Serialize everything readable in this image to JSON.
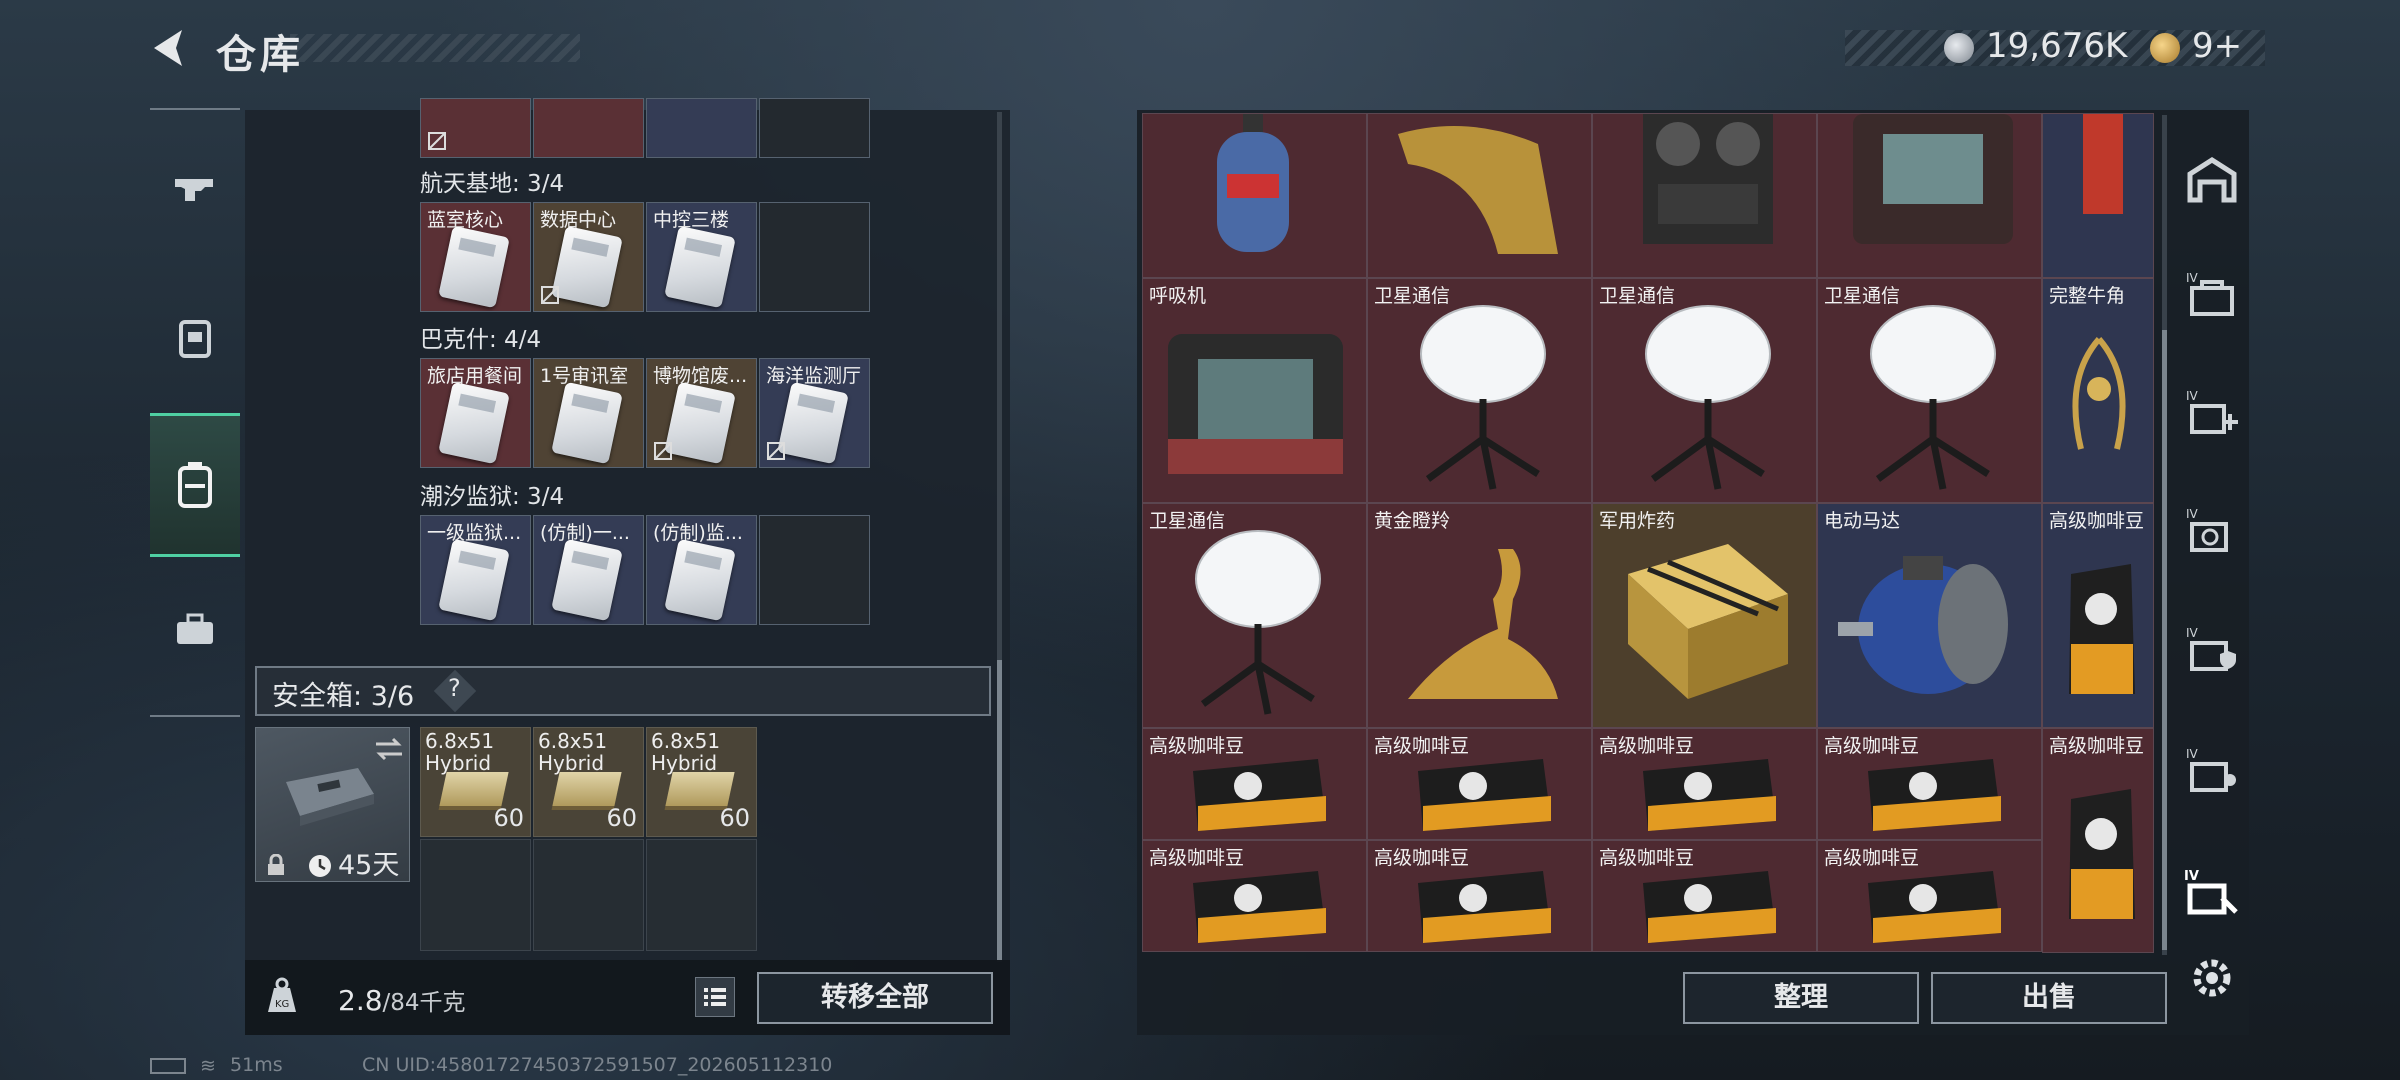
{
  "header": {
    "title": "仓库",
    "silver": "19,676K",
    "gold": "9+"
  },
  "left": {
    "sections": [
      {
        "label": "航天基地: 3/4",
        "cards": [
          "蓝室核心",
          "数据中心",
          "中控三楼",
          ""
        ]
      },
      {
        "label": "巴克什: 4/4",
        "cards": [
          "旅店用餐间",
          "1号审讯室",
          "博物馆废...",
          "海洋监测厅"
        ]
      },
      {
        "label": "潮汐监狱: 3/4",
        "cards": [
          "一级监狱...",
          "(仿制)一...",
          "(仿制)监...",
          ""
        ]
      }
    ],
    "safe": {
      "label": "安全箱:",
      "count": "3/6",
      "help": "?",
      "days": "45天"
    },
    "ammo": [
      {
        "name": "6.8x51 Hybrid",
        "qty": "60"
      },
      {
        "name": "6.8x51 Hybrid",
        "qty": "60"
      },
      {
        "name": "6.8x51 Hybrid",
        "qty": "60"
      }
    ],
    "weight": {
      "current": "2.8",
      "cap": "/84千克"
    },
    "transfer": "转移全部"
  },
  "grid": {
    "row1": [
      "",
      "",
      "",
      "",
      ""
    ],
    "row2": [
      "呼吸机",
      "卫星通信",
      "卫星通信",
      "卫星通信",
      "完整牛角"
    ],
    "row3": [
      "卫星通信",
      "黄金瞪羚",
      "军用炸药",
      "电动马达",
      "高级咖啡豆"
    ],
    "row4": [
      "高级咖啡豆",
      "高级咖啡豆",
      "高级咖啡豆",
      "高级咖啡豆",
      "高级咖啡豆"
    ],
    "row5": [
      "高级咖啡豆",
      "高级咖啡豆",
      "高级咖啡豆",
      "高级咖啡豆"
    ]
  },
  "actions": {
    "sort": "整理",
    "sell": "出售"
  },
  "status": {
    "ping": "51ms",
    "uid": "CN UID:4580172745037259150​7_202605112310"
  },
  "colors": {
    "accent": "#4fd0a2",
    "red_slot": "#4e2a31",
    "blue_slot": "#2f3650",
    "gold_slot": "#4d3f2c"
  }
}
